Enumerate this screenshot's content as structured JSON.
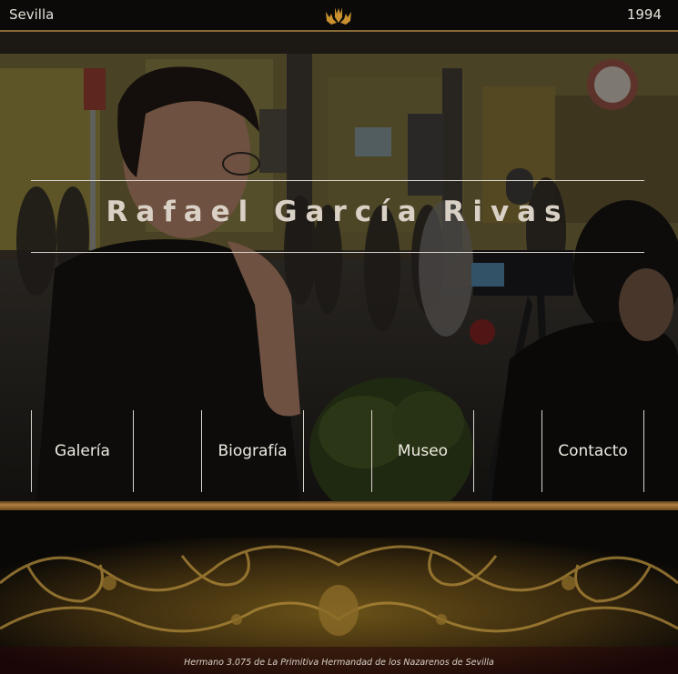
{
  "header": {
    "city": "Sevilla",
    "year": "1994",
    "logo_icon": "hands-emblem-icon"
  },
  "hero": {
    "title": "Rafael García Rivas",
    "background_image": "photo of a man with glasses beside a film camera on a street at dusk"
  },
  "nav": {
    "items": [
      {
        "label": "Galería"
      },
      {
        "label": "Biografía"
      },
      {
        "label": "Museo"
      },
      {
        "label": "Contacto"
      }
    ]
  },
  "footer": {
    "text": "Hermano 3.075 de La Primitiva Hermandad de los Nazarenos de Sevilla"
  },
  "colors": {
    "accent_gold": "#b08040",
    "title_text": "#d9d1c5",
    "background": "#050403"
  }
}
